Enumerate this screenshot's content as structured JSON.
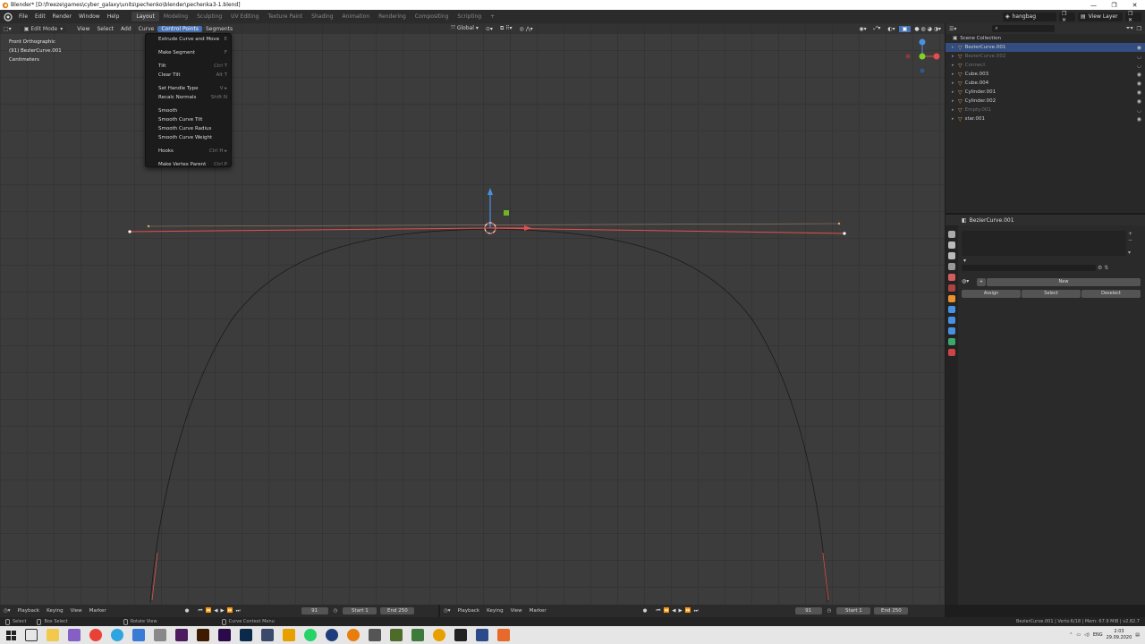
{
  "window": {
    "title": "Blender* [D:\\freeze\\games\\cyber_galaxy\\units\\pechenko\\blender\\pechenka3-1.blend]",
    "controls": [
      "—",
      "❐",
      "✕"
    ]
  },
  "topbar": {
    "menus": [
      "File",
      "Edit",
      "Render",
      "Window",
      "Help"
    ],
    "workspaces": [
      "Layout",
      "Modeling",
      "Sculpting",
      "UV Editing",
      "Texture Paint",
      "Shading",
      "Animation",
      "Rendering",
      "Compositing",
      "Scripting"
    ],
    "active_workspace": "Layout",
    "add_tab": "+",
    "scene_name": "hangbag",
    "view_layer": "View Layer"
  },
  "viewport": {
    "mode": "Edit Mode",
    "menus": [
      "View",
      "Select",
      "Add",
      "Curve",
      "Control Points",
      "Segments"
    ],
    "active_menu": "Control Points",
    "orientation": "Global",
    "overlay_lines": [
      "Front Orthographic",
      "(91) BezierCurve.001",
      "Centimeters"
    ],
    "curve_color": "#e84d4d",
    "axes": {
      "x_color": "#e84d4d",
      "y_color": "#7ed321",
      "z_color": "#4a90e2"
    }
  },
  "dropdown": {
    "groups": [
      [
        {
          "label": "Extrude Curve and Move",
          "shortcut": "E"
        }
      ],
      [
        {
          "label": "Make Segment",
          "shortcut": "F"
        }
      ],
      [
        {
          "label": "Tilt",
          "shortcut": "Ctrl T"
        },
        {
          "label": "Clear Tilt",
          "shortcut": "Alt T"
        }
      ],
      [
        {
          "label": "Set Handle Type",
          "shortcut": "V ▸"
        },
        {
          "label": "Recalc Normals",
          "shortcut": "Shift N"
        }
      ],
      [
        {
          "label": "Smooth",
          "shortcut": ""
        },
        {
          "label": "Smooth Curve Tilt",
          "shortcut": ""
        },
        {
          "label": "Smooth Curve Radius",
          "shortcut": ""
        },
        {
          "label": "Smooth Curve Weight",
          "shortcut": ""
        }
      ],
      [
        {
          "label": "Hooks",
          "shortcut": "Ctrl H ▸"
        }
      ],
      [
        {
          "label": "Make Vertex Parent",
          "shortcut": "Ctrl P"
        }
      ]
    ]
  },
  "outliner": {
    "collection": "Scene Collection",
    "rows": [
      {
        "name": "BezierCurve.001",
        "state": "selected"
      },
      {
        "name": "BezierCurve.002",
        "state": "hidden"
      },
      {
        "name": "Connect",
        "state": "hidden"
      },
      {
        "name": "Cube.003",
        "state": "visible"
      },
      {
        "name": "Cube.004",
        "state": "visible"
      },
      {
        "name": "Cylinder.001",
        "state": "visible"
      },
      {
        "name": "Cylinder.002",
        "state": "visible"
      },
      {
        "name": "Empty.001",
        "state": "hidden"
      },
      {
        "name": "star.001",
        "state": "visible"
      }
    ]
  },
  "properties": {
    "object_name": "BezierCurve.001",
    "new_label": "New",
    "buttons": [
      "Assign",
      "Select",
      "Deselect"
    ]
  },
  "timeline": {
    "menus": [
      "Playback",
      "Keying",
      "View",
      "Marker"
    ],
    "current_frame": "91",
    "start_label": "Start",
    "start": "1",
    "end_label": "End",
    "end": "250"
  },
  "statusbar": {
    "hints": [
      "Select",
      "Box Select",
      "Rotate View",
      "Curve Context Menu"
    ],
    "stats": "BezierCurve.001 | Verts:6/18 | Mem: 67.9 MiB | v2.82.7"
  },
  "taskbar": {
    "lang": "ENG",
    "time": "2:03",
    "date": "29.09.2020"
  }
}
